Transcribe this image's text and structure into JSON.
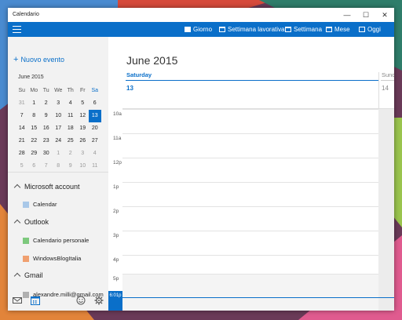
{
  "window": {
    "title": "Calendario",
    "controls": [
      "—",
      "☐",
      "✕"
    ]
  },
  "toolbar": {
    "buttons": [
      {
        "label": "Giorno"
      },
      {
        "label": "Settimana lavorativa"
      },
      {
        "label": "Settimana"
      },
      {
        "label": "Mese"
      },
      {
        "label": "Oggi"
      }
    ]
  },
  "sidebar": {
    "new_event": "Nuovo evento",
    "mini_calendar": {
      "title": "June 2015",
      "weekdays": [
        "Su",
        "Mo",
        "Tu",
        "We",
        "Th",
        "Fr",
        "Sa"
      ],
      "weeks": [
        [
          "31",
          "1",
          "2",
          "3",
          "4",
          "5",
          "6"
        ],
        [
          "7",
          "8",
          "9",
          "10",
          "11",
          "12",
          "13"
        ],
        [
          "14",
          "15",
          "16",
          "17",
          "18",
          "19",
          "20"
        ],
        [
          "21",
          "22",
          "23",
          "24",
          "25",
          "26",
          "27"
        ],
        [
          "28",
          "29",
          "30",
          "1",
          "2",
          "3",
          "4"
        ],
        [
          "5",
          "6",
          "7",
          "8",
          "9",
          "10",
          "11"
        ]
      ],
      "selected": "13"
    },
    "groups": [
      {
        "name": "Microsoft account",
        "calendars": [
          {
            "name": "Calendar",
            "color": "#a9c8e8"
          }
        ]
      },
      {
        "name": "Outlook",
        "calendars": [
          {
            "name": "Calendario personale",
            "color": "#7dc97d"
          },
          {
            "name": "WindowsBlogItalia",
            "color": "#f0a070"
          }
        ]
      },
      {
        "name": "Gmail",
        "calendars": [
          {
            "name": "alexandre.milli@gmail.com",
            "color": "#b0b0b0"
          }
        ]
      }
    ],
    "bottom_icons": [
      "mail-icon",
      "calendar-icon",
      "smiley-icon",
      "gear-icon"
    ]
  },
  "main": {
    "month_title": "June 2015",
    "days": [
      {
        "name": "Saturday",
        "number": "13"
      },
      {
        "name": "Sunda",
        "number": "14"
      }
    ],
    "hours": [
      "10a",
      "11a",
      "12p",
      "1p",
      "2p",
      "3p",
      "4p",
      "5p"
    ],
    "now_label": "6:01p"
  },
  "colors": {
    "accent": "#0a6fc9",
    "sidebar_bg": "#f2f2f2"
  }
}
